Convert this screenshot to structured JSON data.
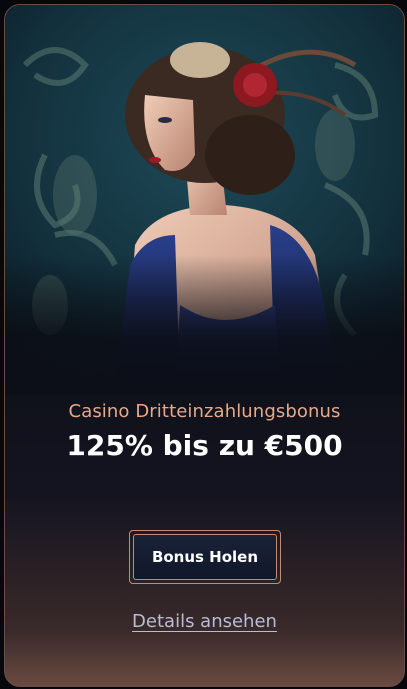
{
  "bonus": {
    "subtitle": "Casino Dritteinzahlungsbonus",
    "headline": "125% bis zu €500",
    "cta_label": "Bonus Holen",
    "details_label": "Details ansehen"
  },
  "colors": {
    "subtitle": "#e8a88a",
    "headline": "#ffffff",
    "cta_border": "#c48a74",
    "cta_background": "#141c30",
    "details_link": "#b8bcd6"
  },
  "hero_image": {
    "icon": "flapper-woman-portrait"
  }
}
